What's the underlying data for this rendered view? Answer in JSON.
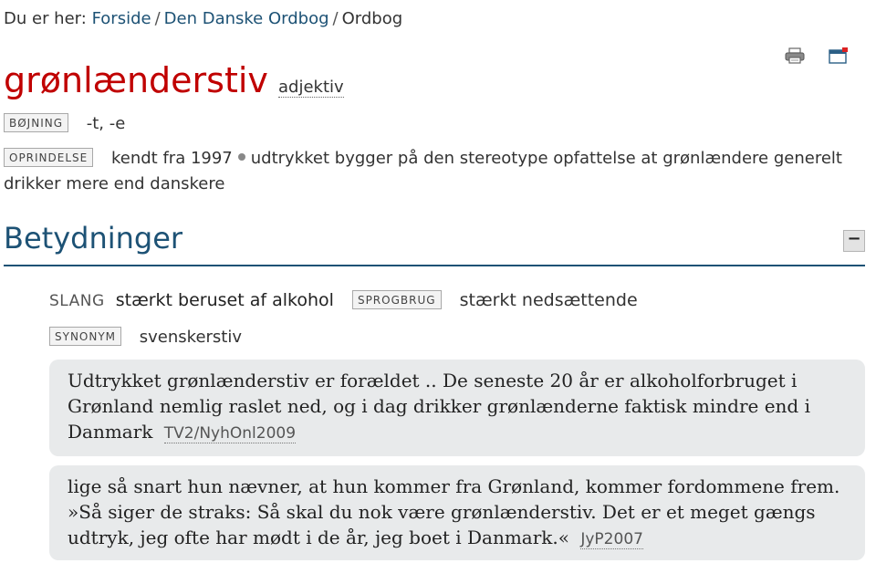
{
  "breadcrumb": {
    "prefix": "Du er her:",
    "items": [
      "Forside",
      "Den Danske Ordbog",
      "Ordbog"
    ],
    "separator": "/"
  },
  "tools": {
    "print_icon": "printer-icon",
    "window_icon": "new-window-icon"
  },
  "entry": {
    "headword": "grønlænderstiv",
    "pos": "adjektiv",
    "inflection": {
      "label": "BØJNING",
      "value": "-t, -e"
    },
    "origin": {
      "label": "OPRINDELSE",
      "year_text": "kendt fra 1997",
      "text": "udtrykket bygger på den stereotype opfattelse at grønlændere generelt drikker mere end danskere"
    }
  },
  "section": {
    "title": "Betydninger",
    "collapse_label": "−"
  },
  "meaning": {
    "register": "SLANG",
    "definition": "stærkt beruset af alkohol",
    "usage_label": "SPROGBRUG",
    "usage_value": "stærkt nedsættende",
    "synonym_label": "SYNONYM",
    "synonym_value": "svenskerstiv"
  },
  "citations": [
    {
      "text": "Udtrykket grønlænderstiv er forældet .. De seneste 20 år er alkoholforbruget i Grønland nemlig raslet ned, og i dag drikker grønlænderne faktisk mindre end i Danmark",
      "source": "TV2/NyhOnl2009"
    },
    {
      "text": "lige så snart hun nævner, at hun kommer fra Grønland, kommer fordommene frem. »Så siger de straks: Så skal du nok være grønlænderstiv. Det er et meget gængs udtryk, jeg ofte har mødt i de år, jeg boet i Danmark.«",
      "source": "JyP2007"
    }
  ],
  "colors": {
    "headword": "#c00000",
    "link": "#1d5275",
    "citation_bg": "#e8eaeb"
  }
}
